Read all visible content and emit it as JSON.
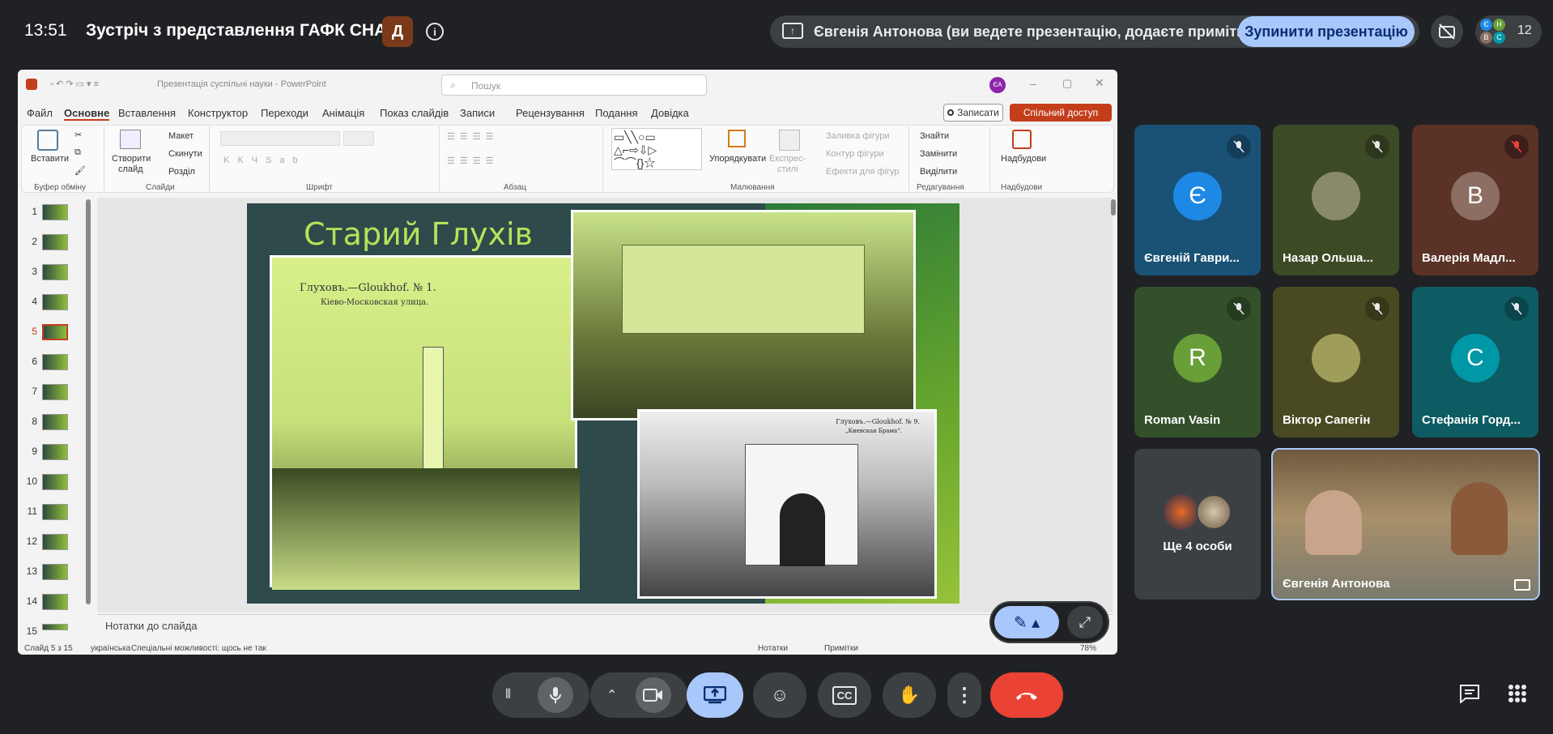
{
  "topbar": {
    "time": "13:51",
    "meeting_title": "Зустріч з представлення ГАФК СНАУ",
    "host_badge": "Д",
    "presenting_text": "Євгенія Антонова (ви ведете презентацію, додаєте примітки)",
    "stop_button": "Зупинити презентацію",
    "participant_count": "12",
    "mini_avatars": [
      "Є",
      "Н",
      "В",
      "С"
    ]
  },
  "ppt": {
    "title": "Презентація суспільні науки  -  PowerPoint",
    "search_placeholder": "Пошук",
    "user_initials": "ЄА",
    "tabs": [
      "Файл",
      "Основне",
      "Вставлення",
      "Конструктор",
      "Переходи",
      "Анімація",
      "Показ слайдів",
      "Записи",
      "Рецензування",
      "Подання",
      "Довідка"
    ],
    "record_button": "Записати",
    "share_button": "Спільний доступ",
    "ribbon": {
      "paste": "Вставити",
      "new_slide_1": "Створити",
      "new_slide_2": "слайд",
      "layout": "Макет",
      "reset": "Скинути",
      "section": "Розділ",
      "arrange": "Упорядкувати",
      "styles_1": "Експрес-",
      "styles_2": "стилі",
      "fill": "Заливка фігури",
      "outline": "Контур фігури",
      "effects": "Ефекти для фігур",
      "find": "Знайти",
      "replace": "Замінити",
      "select": "Виділити",
      "addins": "Надбудови",
      "groups": [
        "Буфер обміну",
        "Слайди",
        "Шрифт",
        "Абзац",
        "Малювання",
        "Редагування",
        "Надбудови"
      ]
    },
    "slide_numbers": [
      "1",
      "2",
      "3",
      "4",
      "5",
      "6",
      "7",
      "8",
      "9",
      "10",
      "11",
      "12",
      "13",
      "14",
      "15"
    ],
    "active_slide": 5,
    "slide": {
      "title": "Старий Глухів",
      "caption_1": "Глуховъ.—Gloukhof. № 1.",
      "caption_1b": "Кіево-Московская улица.",
      "caption_2": "Глуховъ.—Gloukhof. № 9.",
      "caption_2b": "„Киевская Брама“."
    },
    "notes_placeholder": "Нотатки до слайда",
    "status": {
      "slide_of": "Слайд 5 з 15",
      "language": "українська",
      "accessibility": "Спеціальні можливості: щось не так",
      "notes": "Нотатки",
      "comments": "Примітки",
      "zoom": "78%"
    }
  },
  "participants": [
    {
      "name": "Євгеній Гаври...",
      "initial": "Є",
      "bg": "#1a5276",
      "avatar_bg": "#1e88e5",
      "muted": true
    },
    {
      "name": "Назар Ольша...",
      "initial": "",
      "bg": "#3d4a26",
      "avatar_bg": "#8a8a6a",
      "muted": true
    },
    {
      "name": "Валерія Мадл...",
      "initial": "В",
      "bg": "#5a3226",
      "avatar_bg": "#8d6e63",
      "muted": true
    },
    {
      "name": "Roman Vasin",
      "initial": "R",
      "bg": "#33502a",
      "avatar_bg": "#689f38",
      "muted": true
    },
    {
      "name": "Віктор Сапегін",
      "initial": "",
      "bg": "#4a4a22",
      "avatar_bg": "#9e9d5a",
      "muted": true
    },
    {
      "name": "Стефанія Горд...",
      "initial": "С",
      "bg": "#0d5c63",
      "avatar_bg": "#0097a7",
      "muted": true
    }
  ],
  "more_people": "Ще 4 особи",
  "self_tile_name": "Євгенія Антонова",
  "colors": {
    "accent": "#a8c7fa",
    "end_call": "#ea4335",
    "ppt_share": "#c43e1c"
  }
}
